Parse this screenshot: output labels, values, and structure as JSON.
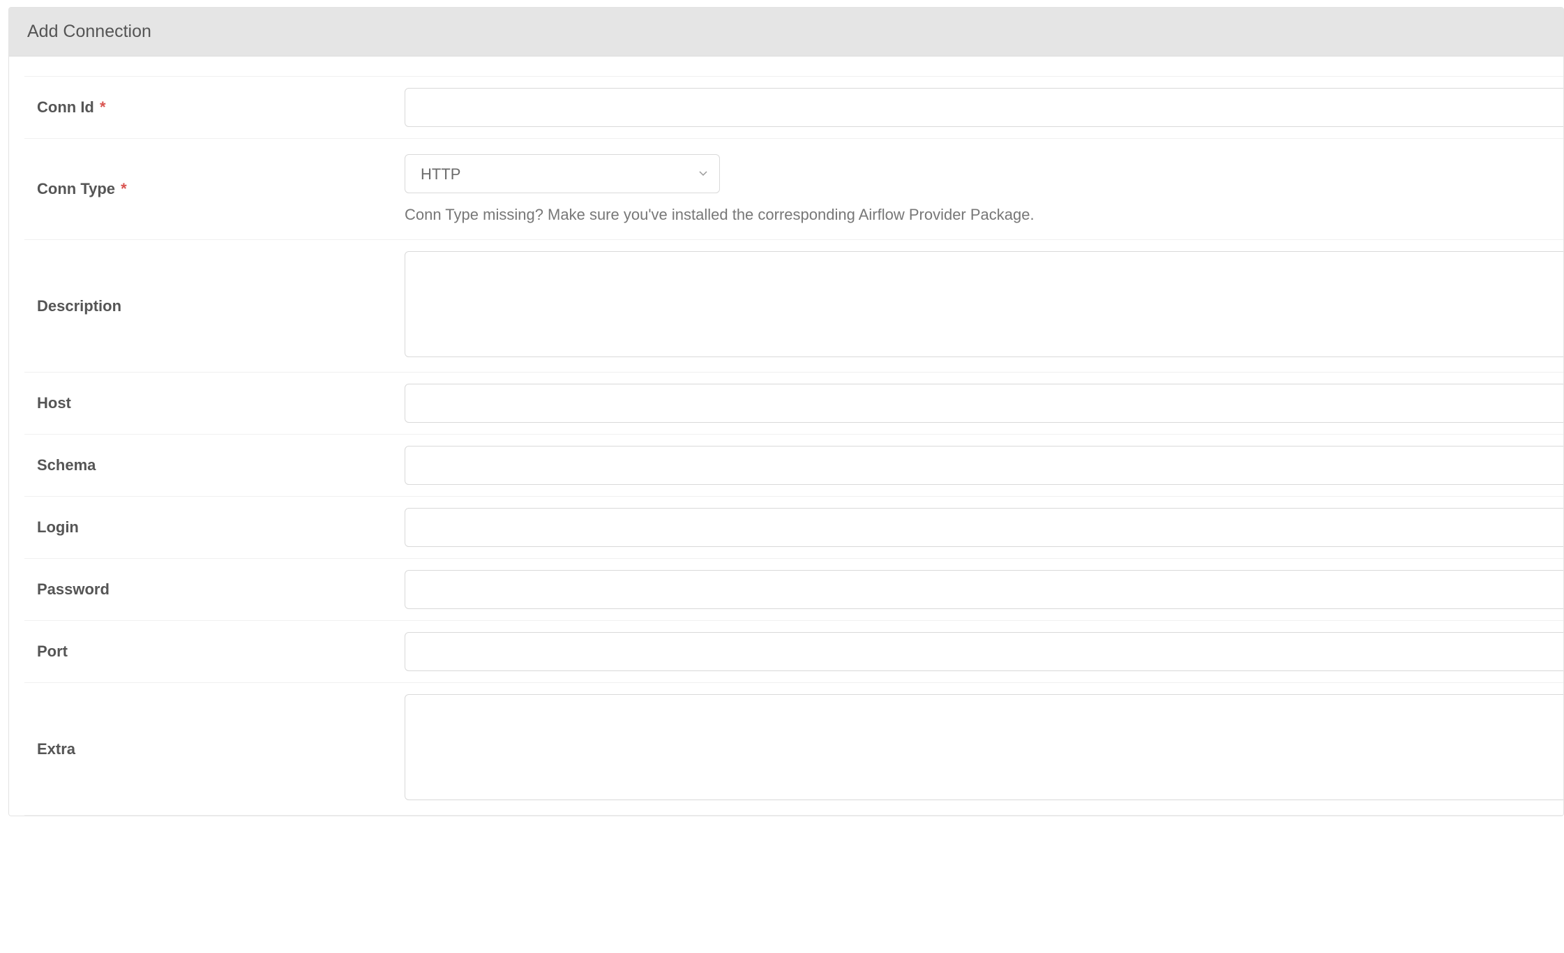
{
  "panel": {
    "title": "Add Connection"
  },
  "form": {
    "conn_id": {
      "label": "Conn Id",
      "required": true,
      "value": ""
    },
    "conn_type": {
      "label": "Conn Type",
      "required": true,
      "selected": "HTTP",
      "helper_text": "Conn Type missing? Make sure you've installed the corresponding Airflow Provider Package."
    },
    "description": {
      "label": "Description",
      "value": ""
    },
    "host": {
      "label": "Host",
      "value": ""
    },
    "schema": {
      "label": "Schema",
      "value": ""
    },
    "login": {
      "label": "Login",
      "value": ""
    },
    "password": {
      "label": "Password",
      "value": ""
    },
    "port": {
      "label": "Port",
      "value": ""
    },
    "extra": {
      "label": "Extra",
      "value": ""
    }
  },
  "required_marker": "*"
}
